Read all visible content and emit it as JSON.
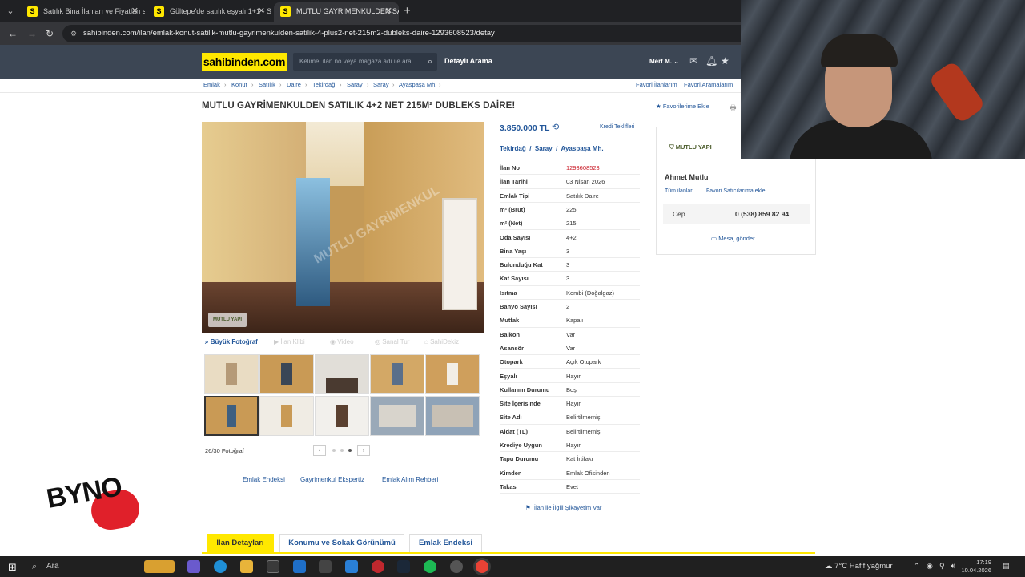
{
  "browser": {
    "tabs": [
      {
        "label": "Satılık Bina İlanları ve Fiyatları sa",
        "active": false
      },
      {
        "label": "Gültepe'de satılık eşyalı 1+1 - S",
        "active": false
      },
      {
        "label": "MUTLU GAYRİMENKULDEN SAT",
        "active": true
      }
    ],
    "url": "sahibinden.com/ilan/emlak-konut-satilik-mutlu-gayrimenkulden-satilik-4-plus2-net-215m2-dubleks-daire-1293608523/detay"
  },
  "header": {
    "logo": "sahibinden.com",
    "search_placeholder": "Kelime, ilan no veya mağaza adı ile ara",
    "detailed_search": "Detaylı Arama",
    "user": "Mert M."
  },
  "breadcrumb": [
    "Emlak",
    "Konut",
    "Satılık",
    "Daire",
    "Tekirdağ",
    "Saray",
    "Saray",
    "Ayaspaşa Mh."
  ],
  "top_links": {
    "fav_listings": "Favori İlanlarım",
    "fav_searches": "Favori Aramalarım"
  },
  "listing": {
    "title": "MUTLU GAYRİMENKULDEN SATILIK 4+2 NET 215M² DUBLEKS DAİRE!",
    "add_favorite": "Favorilerime Ekle",
    "price": "3.850.000 TL",
    "loan_offers": "Kredi Teklifleri",
    "location": [
      "Tekirdağ",
      "Saray",
      "Ayaspaşa Mh."
    ],
    "details": [
      {
        "key": "İlan No",
        "value": "1293608523",
        "highlight": true
      },
      {
        "key": "İlan Tarihi",
        "value": "03 Nisan 2026"
      },
      {
        "key": "Emlak Tipi",
        "value": "Satılık Daire"
      },
      {
        "key": "m² (Brüt)",
        "value": "225"
      },
      {
        "key": "m² (Net)",
        "value": "215"
      },
      {
        "key": "Oda Sayısı",
        "value": "4+2"
      },
      {
        "key": "Bina Yaşı",
        "value": "3"
      },
      {
        "key": "Bulunduğu Kat",
        "value": "3"
      },
      {
        "key": "Kat Sayısı",
        "value": "3"
      },
      {
        "key": "Isıtma",
        "value": "Kombi (Doğalgaz)"
      },
      {
        "key": "Banyo Sayısı",
        "value": "2"
      },
      {
        "key": "Mutfak",
        "value": "Kapalı"
      },
      {
        "key": "Balkon",
        "value": "Var"
      },
      {
        "key": "Asansör",
        "value": "Var"
      },
      {
        "key": "Otopark",
        "value": "Açık Otopark"
      },
      {
        "key": "Eşyalı",
        "value": "Hayır"
      },
      {
        "key": "Kullanım Durumu",
        "value": "Boş"
      },
      {
        "key": "Site İçerisinde",
        "value": "Hayır"
      },
      {
        "key": "Site Adı",
        "value": "Belirtilmemiş"
      },
      {
        "key": "Aidat (TL)",
        "value": "Belirtilmemiş"
      },
      {
        "key": "Krediye Uygun",
        "value": "Hayır"
      },
      {
        "key": "Tapu Durumu",
        "value": "Kat İrtifakı"
      },
      {
        "key": "Kimden",
        "value": "Emlak Ofisinden"
      },
      {
        "key": "Takas",
        "value": "Evet"
      }
    ],
    "complaint": "İlan ile İlgili Şikayetim Var"
  },
  "photo": {
    "watermark": "MUTLU GAYRİMENKUL",
    "badge": "MUTLU YAPI",
    "tabs": [
      "Büyük Fotoğraf",
      "İlan Klibi",
      "Video",
      "Sanal Tur",
      "SahiDekiz"
    ],
    "count": "26/30 Fotoğraf"
  },
  "below_links": [
    "Emlak Endeksi",
    "Gayrimenkul Ekspertiz",
    "Emlak Alım Rehberi"
  ],
  "seller": {
    "logo_text": "MUTLU YAPI",
    "name": "Ahmet Mutlu",
    "all_listings": "Tüm ilanları",
    "fav_seller": "Favori Satıcılarıma ekle",
    "phone_label": "Cep",
    "phone": "0 (538) 859 82 94",
    "message": "Mesaj gönder"
  },
  "bottom_tabs": [
    "İlan Detayları",
    "Konumu ve Sokak Görünümü",
    "Emlak Endeksi"
  ],
  "overlay": {
    "stamp": "BYNO"
  },
  "taskbar": {
    "search": "Ara",
    "weather": "7°C  Hafif yağmur",
    "time": "17:19",
    "date": "10.04.2026"
  },
  "colors": {
    "brand_yellow": "#ffe800",
    "header_bg": "#3c4654",
    "link": "#225699",
    "highlight_red": "#c91b27"
  }
}
